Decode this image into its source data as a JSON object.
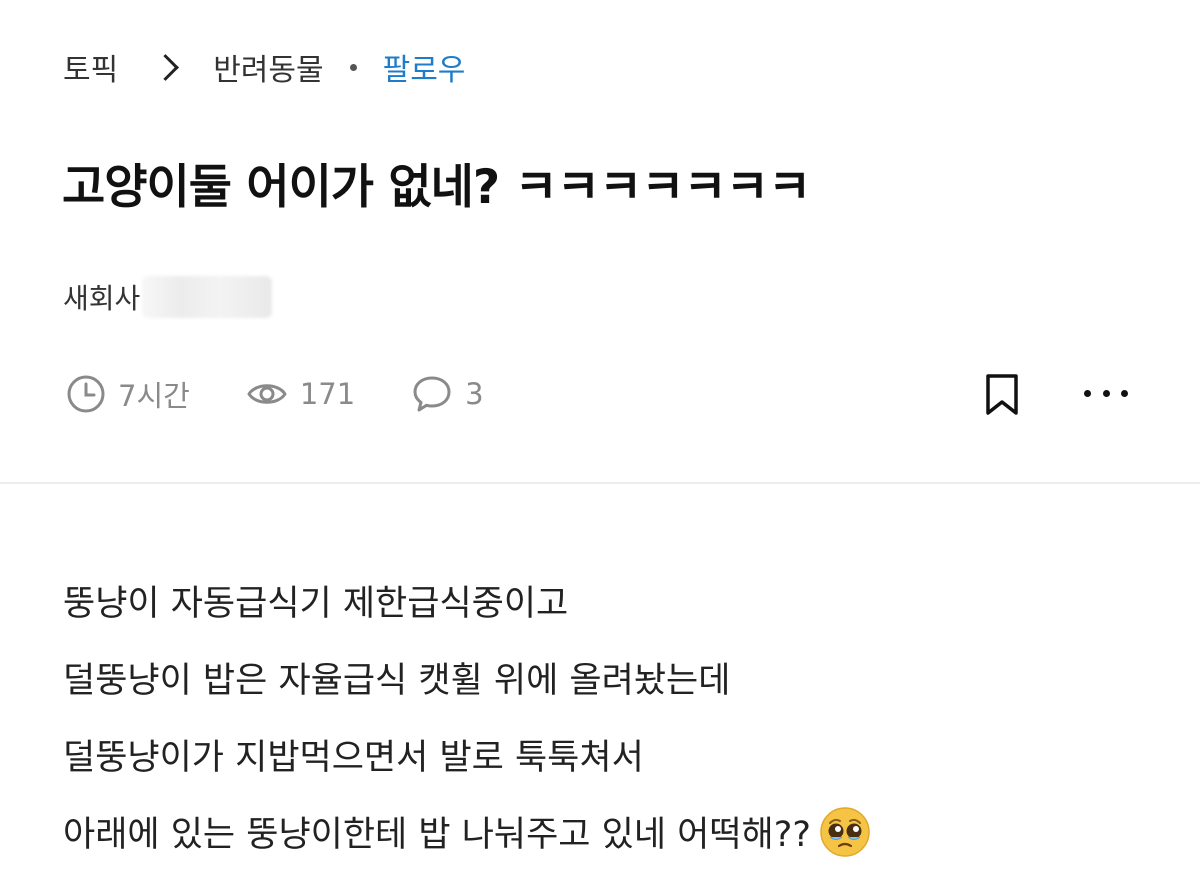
{
  "breadcrumb": {
    "topic": "토픽",
    "category": "반려동물",
    "follow": "팔로우"
  },
  "post": {
    "title": "고양이둘 어이가 없네? ㅋㅋㅋㅋㅋㅋㅋ",
    "author_company": "새회사",
    "meta": {
      "time": "7시간",
      "views": "171",
      "comments": "3"
    },
    "body_lines": [
      "뚱냥이 자동급식기 제한급식중이고",
      "덜뚱냥이 밥은 자율급식 캣휠 위에 올려놨는데",
      "덜뚱냥이가 지밥먹으면서 발로 툭툭쳐서",
      "아래에 있는 뚱냥이한테 밥 나눠주고 있네 어떡해??"
    ]
  },
  "icons": {
    "chevron": "chevron-right-icon",
    "clock": "clock-icon",
    "views": "eye-icon",
    "comments": "speech-bubble-icon",
    "bookmark": "bookmark-icon",
    "more": "more-horizontal-icon",
    "emoji": "pleading-face-emoji"
  },
  "colors": {
    "follow": "#1f7cc9",
    "meta": "#8a8a8a",
    "divider": "#ececec"
  }
}
